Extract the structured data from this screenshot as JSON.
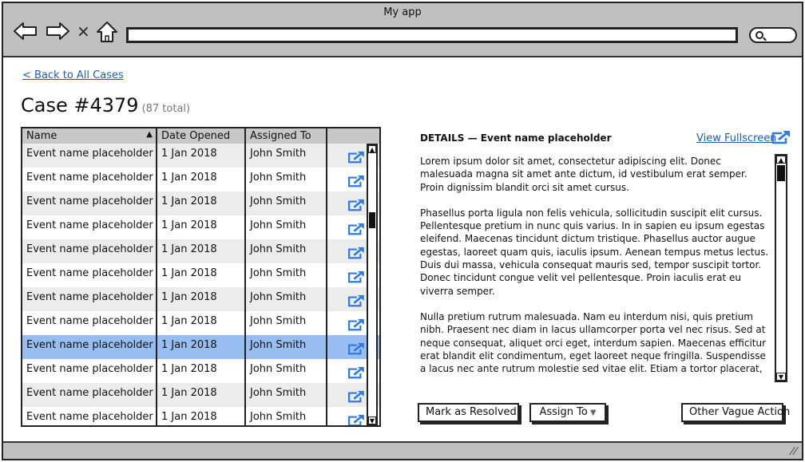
{
  "window": {
    "title": "My app",
    "nav": {
      "back_icon": "arrow-left-icon",
      "forward_icon": "arrow-right-icon",
      "stop_label": "×",
      "home_icon": "home-icon",
      "url_value": "",
      "search_icon": "magnifier-icon"
    }
  },
  "page": {
    "back_link": "< Back to All Cases",
    "case_title": "Case #4379",
    "case_total": "(87 total)"
  },
  "table": {
    "columns": [
      "Name",
      "Date Opened",
      "Assigned To",
      ""
    ],
    "sort_indicator": "▲",
    "sorted_column": "Name",
    "action_icon": "open-external-icon",
    "selected_row_index": 8,
    "rows": [
      {
        "name": "Event name placeholder",
        "date": "1 Jan 2018",
        "assigned": "John Smith"
      },
      {
        "name": "Event name placeholder",
        "date": "1 Jan 2018",
        "assigned": "John Smith"
      },
      {
        "name": "Event name placeholder",
        "date": "1 Jan 2018",
        "assigned": "John Smith"
      },
      {
        "name": "Event name placeholder",
        "date": "1 Jan 2018",
        "assigned": "John Smith"
      },
      {
        "name": "Event name placeholder",
        "date": "1 Jan 2018",
        "assigned": "John Smith"
      },
      {
        "name": "Event name placeholder",
        "date": "1 Jan 2018",
        "assigned": "John Smith"
      },
      {
        "name": "Event name placeholder",
        "date": "1 Jan 2018",
        "assigned": "John Smith"
      },
      {
        "name": "Event name placeholder",
        "date": "1 Jan 2018",
        "assigned": "John Smith"
      },
      {
        "name": "Event name placeholder",
        "date": "1 Jan 2018",
        "assigned": "John Smith"
      },
      {
        "name": "Event name placeholder",
        "date": "1 Jan 2018",
        "assigned": "John Smith"
      },
      {
        "name": "Event name placeholder",
        "date": "1 Jan 2018",
        "assigned": "John Smith"
      },
      {
        "name": "Event name placeholder",
        "date": "1 Jan 2018",
        "assigned": "John Smith"
      }
    ]
  },
  "details": {
    "heading": "DETAILS — Event name placeholder",
    "fullscreen_link": "View Fullscreen",
    "paragraphs": [
      "Lorem ipsum dolor sit amet, consectetur adipiscing elit. Donec malesuada magna sit amet ante dictum, id vestibulum erat semper. Proin dignissim blandit orci sit amet cursus.",
      "Phasellus porta ligula non felis vehicula, sollicitudin suscipit elit cursus. Pellentesque pretium in nunc quis varius. In in sapien eu ipsum egestas eleifend. Maecenas tincidunt dictum tristique. Phasellus auctor augue egestas, laoreet quam quis, iaculis ipsum. Aenean tempus metus lectus. Duis dui massa, vehicula consequat mauris sed, tempor suscipit tortor. Donec tincidunt congue velit vel pellentesque. Proin iaculis erat eu viverra semper.",
      "Nulla pretium rutrum malesuada. Nam eu interdum nisi, quis pretium nibh. Praesent nec diam in lacus ullamcorper porta vel nec risus. Sed at neque consequat, aliquet orci eget, interdum sapien. Maecenas efficitur erat blandit elit condimentum, eget laoreet neque fringilla. Suspendisse a lacus nec ante rutrum molestie sed vitae elit. Etiam a tortor placerat, tincidunt mauris a, posuere enim. In pulvinar dapibus felis, eget euismod leo finibus in. Phasellus"
    ]
  },
  "actions": {
    "mark_resolved": "Mark as Resolved",
    "assign_to": "Assign To",
    "assign_caret": "▼",
    "other": "Other Vague Action"
  },
  "scroll": {
    "up_arrow": "▲",
    "down_arrow": "▼"
  },
  "colors": {
    "link": "#1a5bb5",
    "icon_blue": "#2f7be0",
    "selected_row": "#98bdf0",
    "alt_row": "#ececec",
    "chrome": "#c0c0c0"
  }
}
